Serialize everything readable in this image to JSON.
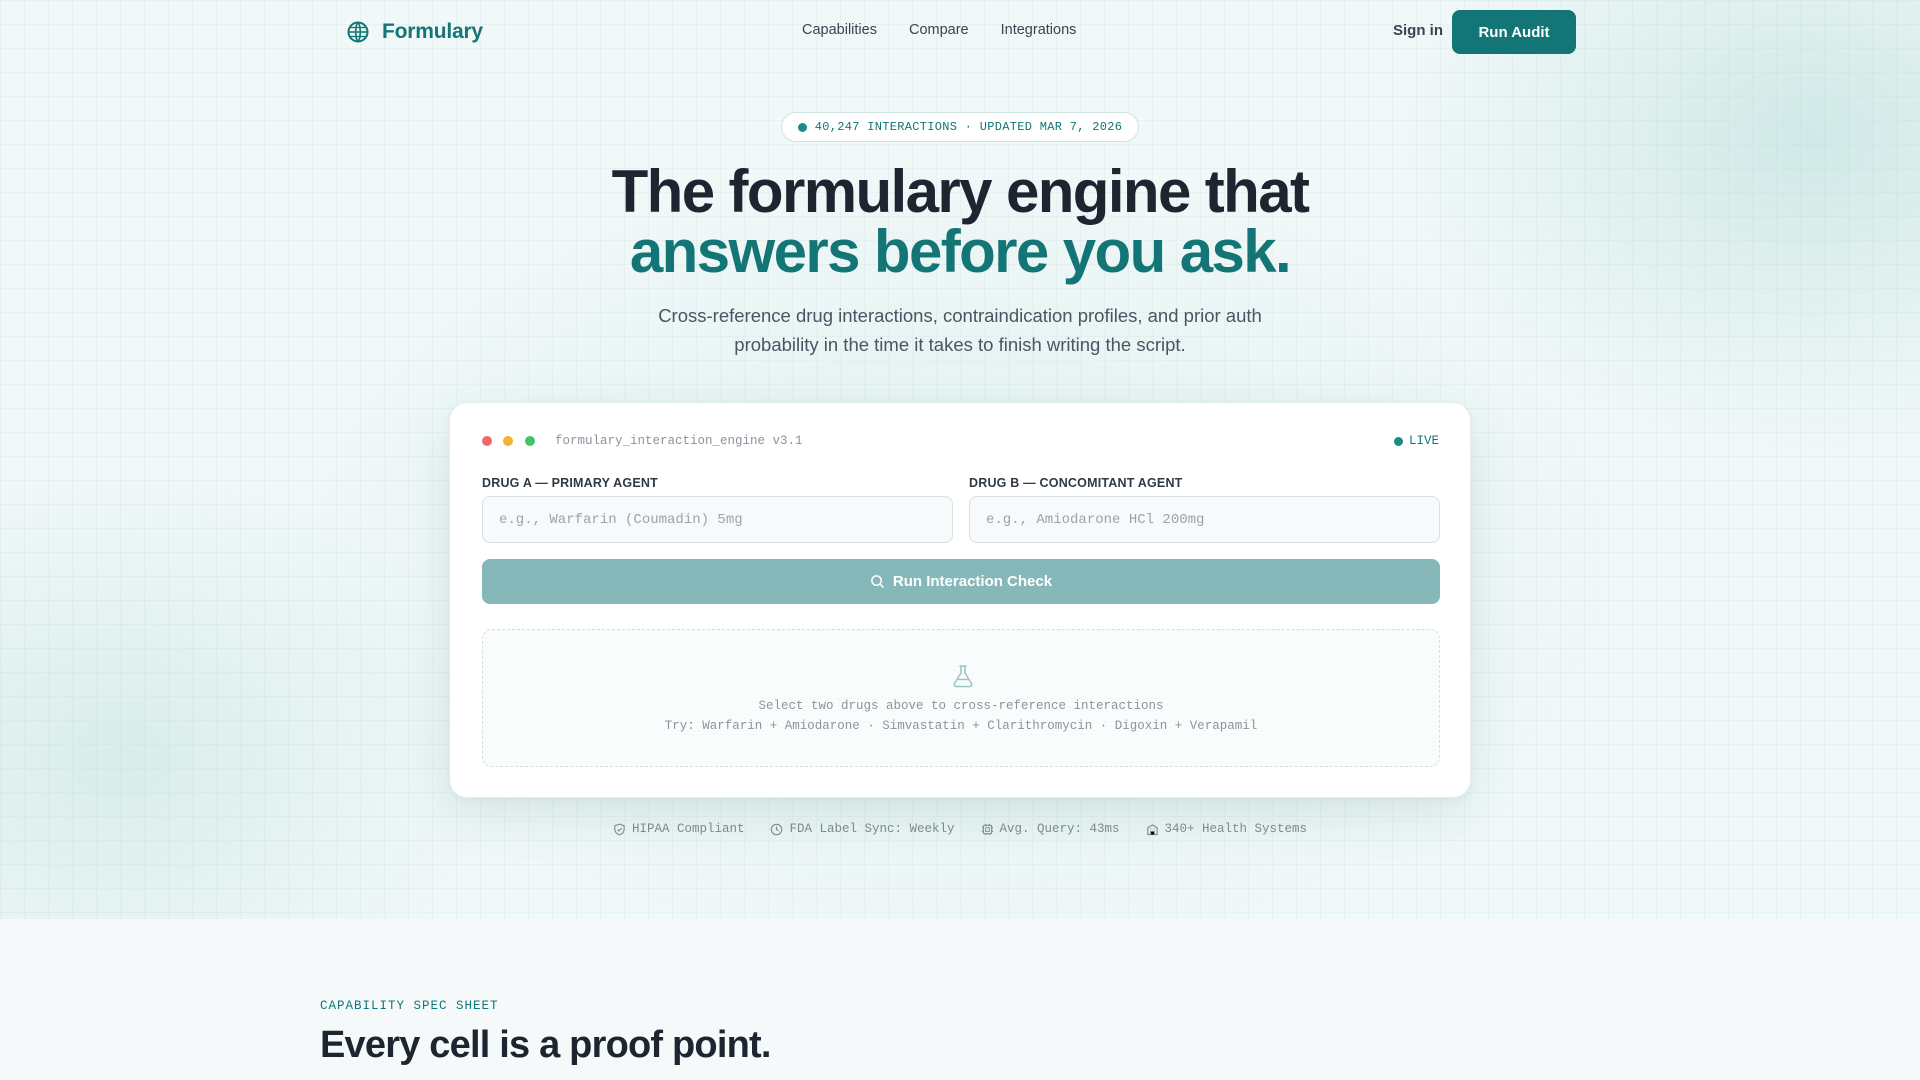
{
  "brand": {
    "name": "Formulary",
    "color": "#137576"
  },
  "nav": {
    "links": [
      "Capabilities",
      "Compare",
      "Integrations"
    ],
    "signin_label": "Sign in",
    "cta_label": "Run Audit"
  },
  "hero": {
    "badge": "40,247 INTERACTIONS · UPDATED MAR 7, 2026",
    "title_line1": "The formulary engine that",
    "title_line2": "answers before you ask.",
    "subtitle": "Cross-reference drug interactions, contraindication profiles, and prior auth probability in the time it takes to finish writing the script."
  },
  "engine_card": {
    "title": "formulary_interaction_engine v3.1",
    "status": "LIVE",
    "drug_a": {
      "label": "DRUG A — PRIMARY AGENT",
      "placeholder": "e.g., Warfarin (Coumadin) 5mg",
      "value": ""
    },
    "drug_b": {
      "label": "DRUG B — CONCOMITANT AGENT",
      "placeholder": "e.g., Amiodarone HCl 200mg",
      "value": ""
    },
    "check_button_label": "Run Interaction Check",
    "empty_state": {
      "line1": "Select two drugs above to cross-reference interactions",
      "line2": "Try: Warfarin + Amiodarone · Simvastatin + Clarithromycin · Digoxin + Verapamil"
    }
  },
  "trust": [
    {
      "icon": "shield-icon",
      "label": "HIPAA Compliant"
    },
    {
      "icon": "clock-icon",
      "label": "FDA Label Sync: Weekly"
    },
    {
      "icon": "chip-icon",
      "label": "Avg. Query: 43ms"
    },
    {
      "icon": "building-icon",
      "label": "340+ Health Systems"
    }
  ],
  "section": {
    "eyebrow": "CAPABILITY SPEC SHEET",
    "title": "Every cell is a proof point."
  }
}
